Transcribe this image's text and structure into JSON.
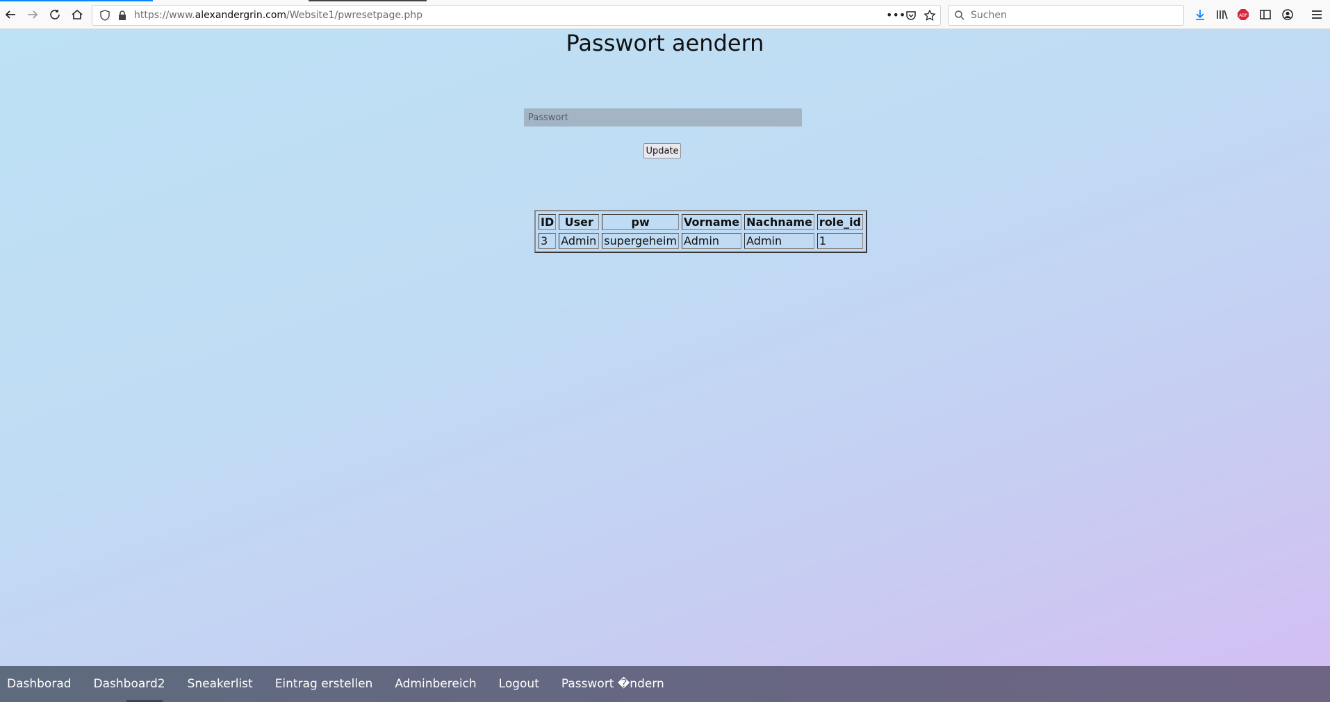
{
  "browser": {
    "url_prefix": "https://www.",
    "url_host": "alexandergrin.com",
    "url_path": "/Website1/pwresetpage.php",
    "search_placeholder": "Suchen"
  },
  "page": {
    "title": "Passwort aendern",
    "password_placeholder": "Passwort",
    "update_label": "Update"
  },
  "table": {
    "headers": [
      "ID",
      "User",
      "pw",
      "Vorname",
      "Nachname",
      "role_id"
    ],
    "rows": [
      [
        "3",
        "Admin",
        "supergeheim",
        "Admin",
        "Admin",
        "1"
      ]
    ]
  },
  "nav": {
    "items": [
      "Dashborad",
      "Dashboard2",
      "Sneakerlist",
      "Eintrag erstellen",
      "Adminbereich",
      "Logout",
      "Passwort �ndern"
    ]
  }
}
